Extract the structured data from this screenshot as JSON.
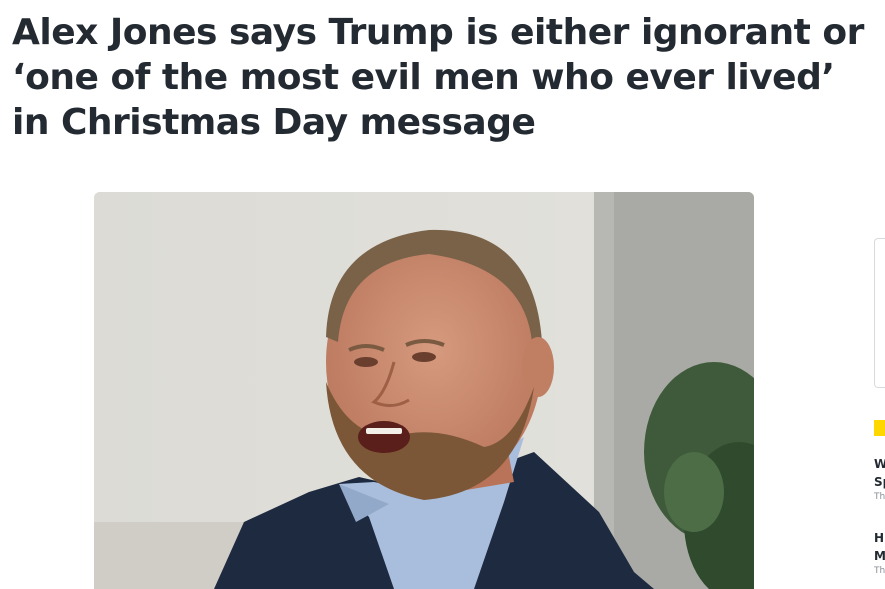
{
  "article": {
    "headline": "Alex Jones says Trump is either ignorant or ‘one of the most evil men who ever lived’ in Christmas Day message"
  },
  "sidebar": {
    "items": [
      {
        "title_line1": "W",
        "title_line2": "Sp",
        "source": "Th"
      },
      {
        "title_line1": "H",
        "title_line2": "M",
        "source": "Th"
      }
    ]
  },
  "colors": {
    "headline": "#232a31",
    "accent": "#ffd700"
  }
}
